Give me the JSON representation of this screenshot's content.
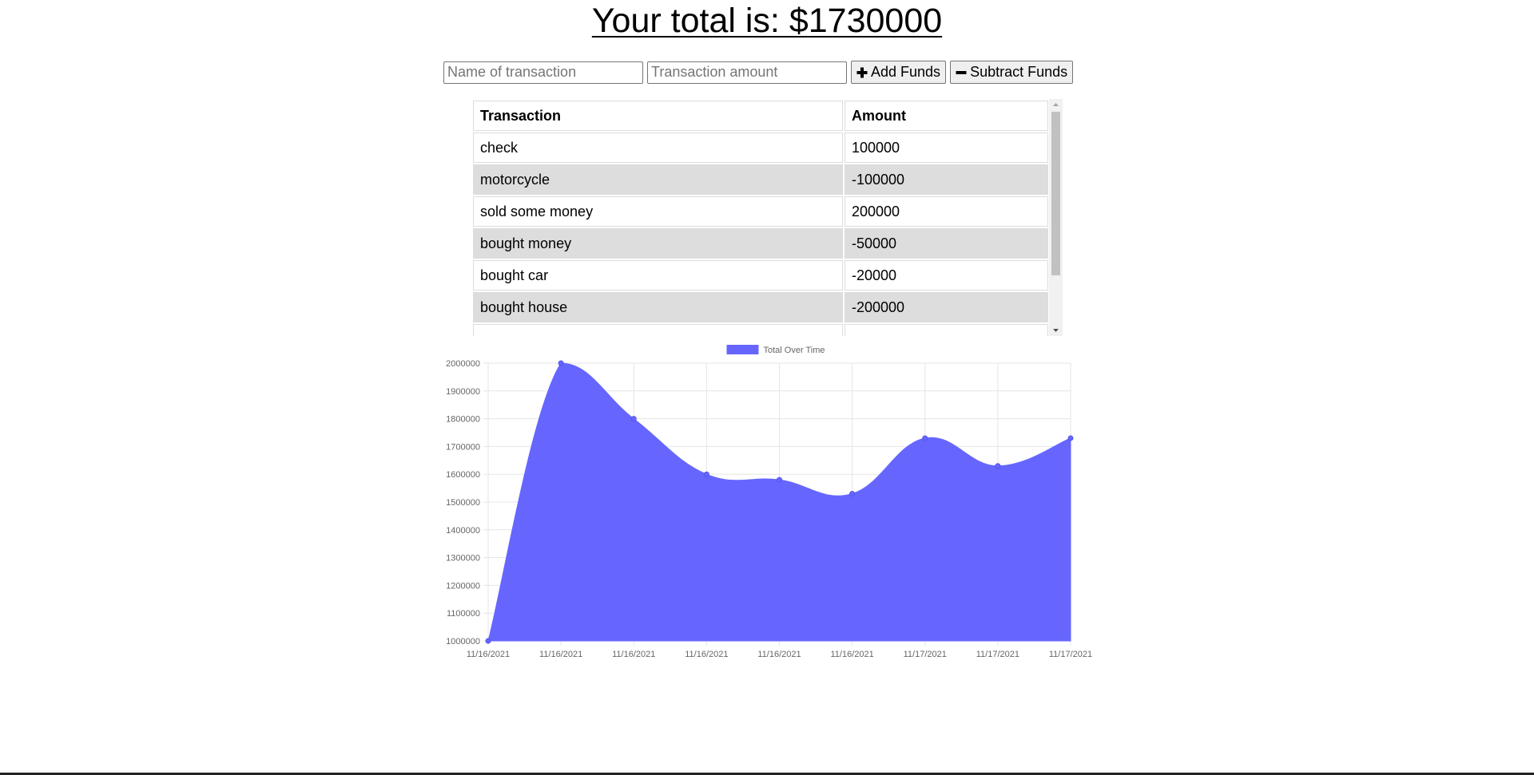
{
  "header": {
    "total_label": "Your total is: $",
    "total_value": "1730000"
  },
  "form": {
    "name_placeholder": "Name of transaction",
    "amount_placeholder": "Transaction amount",
    "add_label": "Add Funds",
    "subtract_label": "Subtract Funds",
    "add_icon": "plus-icon",
    "subtract_icon": "minus-icon"
  },
  "table": {
    "headers": [
      "Transaction",
      "Amount"
    ],
    "rows": [
      {
        "name": "check",
        "amount": "100000"
      },
      {
        "name": "motorcycle",
        "amount": "-100000"
      },
      {
        "name": "sold some money",
        "amount": "200000"
      },
      {
        "name": "bought money",
        "amount": "-50000"
      },
      {
        "name": "bought car",
        "amount": "-20000"
      },
      {
        "name": "bought house",
        "amount": "-200000"
      }
    ],
    "row_alt_color": "#dddddd"
  },
  "chart_data": {
    "type": "area",
    "x": [
      "11/16/2021",
      "11/16/2021",
      "11/16/2021",
      "11/16/2021",
      "11/16/2021",
      "11/16/2021",
      "11/17/2021",
      "11/17/2021",
      "11/17/2021"
    ],
    "series": [
      {
        "name": "Total Over Time",
        "values": [
          1000000,
          2000000,
          1800000,
          1600000,
          1580000,
          1530000,
          1730000,
          1630000,
          1730000
        ],
        "color": "#6666ff"
      }
    ],
    "ylim": [
      1000000,
      2000000
    ],
    "yticks": [
      1000000,
      1100000,
      1200000,
      1300000,
      1400000,
      1500000,
      1600000,
      1700000,
      1800000,
      1900000,
      2000000
    ],
    "grid": true,
    "legend": "top-center",
    "curve": "smooth"
  }
}
